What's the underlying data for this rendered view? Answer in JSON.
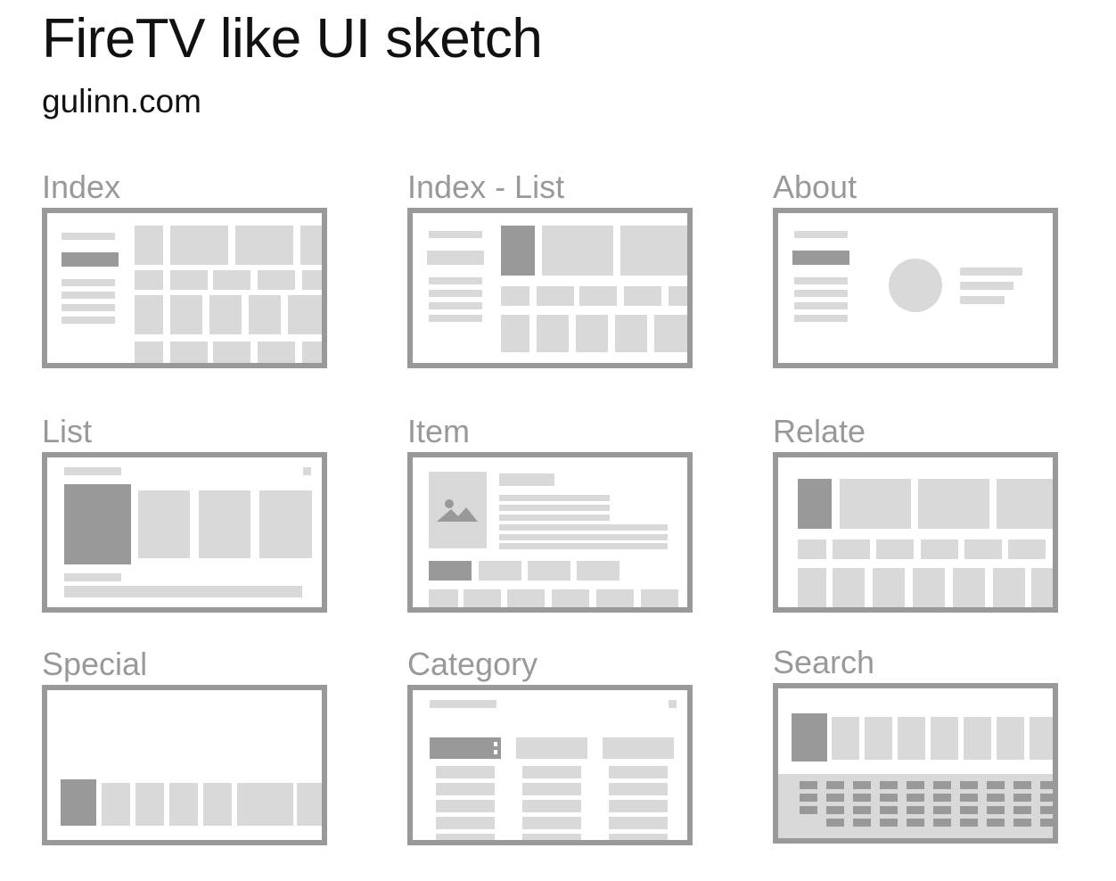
{
  "header": {
    "title": "FireTV like UI sketch",
    "subtitle": "gulinn.com"
  },
  "panels": [
    {
      "label": "Index"
    },
    {
      "label": "Index - List"
    },
    {
      "label": "About"
    },
    {
      "label": "List"
    },
    {
      "label": "Item"
    },
    {
      "label": "Relate"
    },
    {
      "label": "Special"
    },
    {
      "label": "Category"
    },
    {
      "label": "Search"
    }
  ],
  "colors": {
    "frame": "#999999",
    "placeholder_light": "#d9d9d9",
    "placeholder_dark": "#999999",
    "label": "#999999"
  }
}
